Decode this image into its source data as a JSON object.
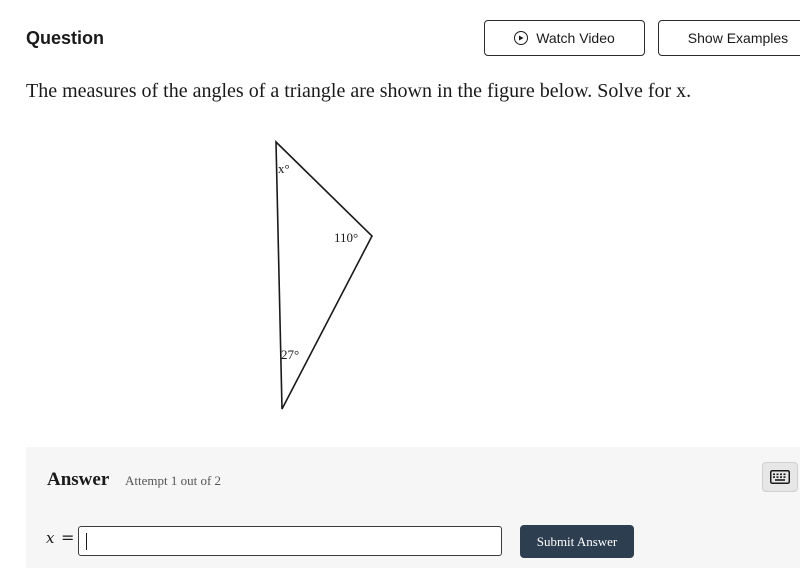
{
  "header": {
    "title": "Question",
    "watch_video_label": "Watch Video",
    "show_examples_label": "Show Examples",
    "play_icon": "play-circle-icon"
  },
  "question": {
    "prompt": "The measures of the angles of a triangle are shown in the figure below. Solve for x."
  },
  "figure": {
    "angle_top_label": "x°",
    "angle_right_label": "110°",
    "angle_bottom_label": "27°"
  },
  "answer": {
    "label": "Answer",
    "attempt_text": "Attempt 1 out of 2",
    "variable": "x",
    "equals": "=",
    "input_value": "",
    "submit_label": "Submit Answer",
    "keyboard_icon": "keyboard-icon"
  },
  "colors": {
    "submit_bg": "#2c3e50",
    "panel_bg": "#f6f6f6"
  }
}
